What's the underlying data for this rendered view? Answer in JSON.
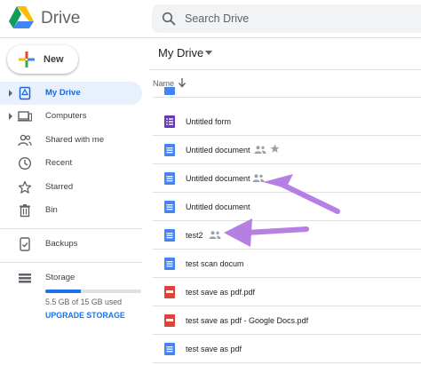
{
  "header": {
    "brand": "Drive",
    "search_placeholder": "Search Drive"
  },
  "sidebar": {
    "new_label": "New",
    "items": [
      {
        "label": "My Drive",
        "icon": "my-drive-icon",
        "active": true,
        "caret": true
      },
      {
        "label": "Computers",
        "icon": "computers-icon",
        "active": false,
        "caret": true
      },
      {
        "label": "Shared with me",
        "icon": "shared-with-me-icon",
        "active": false,
        "caret": false
      },
      {
        "label": "Recent",
        "icon": "recent-icon",
        "active": false,
        "caret": false
      },
      {
        "label": "Starred",
        "icon": "star-icon",
        "active": false,
        "caret": false
      },
      {
        "label": "Bin",
        "icon": "bin-icon",
        "active": false,
        "caret": false
      }
    ],
    "backups_label": "Backups",
    "storage": {
      "label": "Storage",
      "used_text": "5.5 GB of 15 GB used",
      "used_fraction": 0.367,
      "upgrade_label": "UPGRADE STORAGE"
    }
  },
  "main": {
    "title": "My Drive",
    "column_name": "Name",
    "files": [
      {
        "name": "Untitled form",
        "type": "form",
        "shared": false,
        "starred": false
      },
      {
        "name": "Untitled document",
        "type": "doc",
        "shared": true,
        "starred": true
      },
      {
        "name": "Untitled document",
        "type": "doc",
        "shared": true,
        "starred": false
      },
      {
        "name": "Untitled document",
        "type": "doc",
        "shared": false,
        "starred": false
      },
      {
        "name": "test2",
        "type": "doc",
        "shared": true,
        "starred": false
      },
      {
        "name": "test scan docum",
        "type": "doc",
        "shared": false,
        "starred": false
      },
      {
        "name": "test save as pdf.pdf",
        "type": "pdf",
        "shared": false,
        "starred": false
      },
      {
        "name": "test save as pdf - Google Docs.pdf",
        "type": "pdf",
        "shared": false,
        "starred": false
      },
      {
        "name": "test save as pdf",
        "type": "doc",
        "shared": false,
        "starred": false
      }
    ]
  },
  "colors": {
    "accent_blue": "#1a73e8",
    "active_bg": "#e8f0fe",
    "doc_blue": "#4285f4",
    "form_purple": "#673ab7",
    "pdf_red": "#db4437",
    "annotation_purple": "#b57fe3"
  }
}
